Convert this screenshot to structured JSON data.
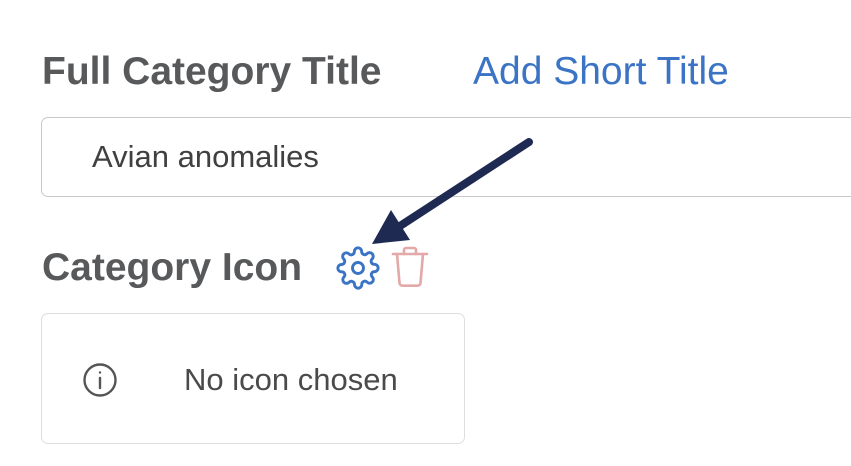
{
  "form": {
    "title_label": "Full Category Title",
    "short_title_link": "Add Short Title",
    "title_value": "Avian anomalies",
    "icon_label": "Category Icon",
    "icon_placeholder_text": "No icon chosen"
  },
  "icons": {
    "settings": "gear-icon",
    "delete": "trash-icon",
    "info": "info-icon",
    "annotation": "arrow-icon"
  },
  "colors": {
    "label": "#58595b",
    "link": "#3b74c4",
    "gear": "#3b74c4",
    "trash": "#e3a8a8",
    "arrow": "#1e2a52"
  }
}
